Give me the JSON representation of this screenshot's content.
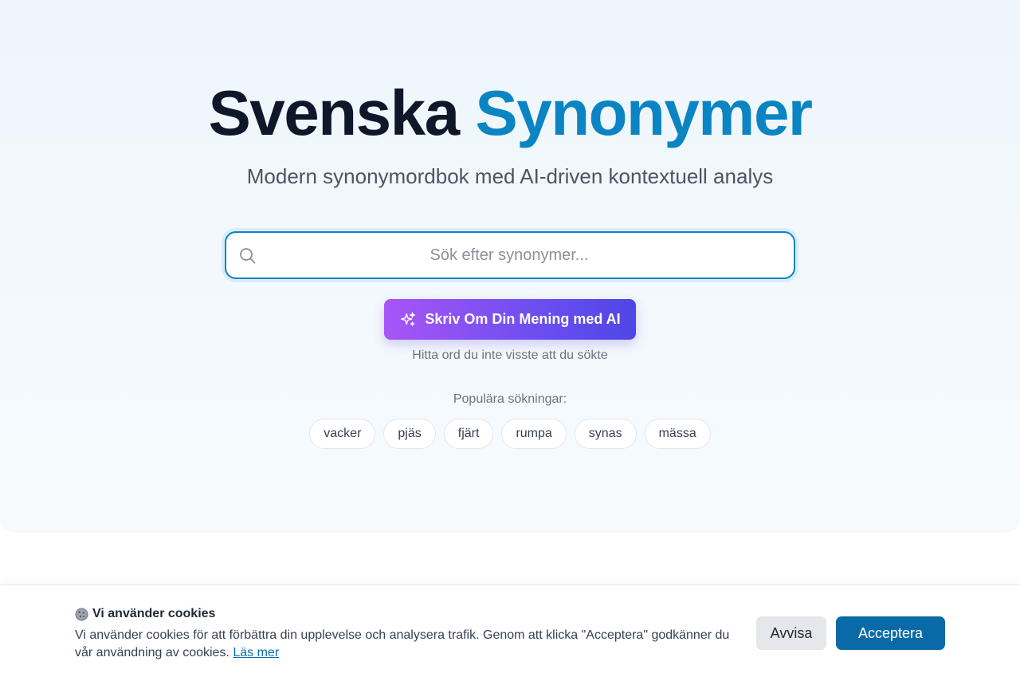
{
  "header": {
    "title_part1": "Svenska",
    "title_part2": "Synonymer",
    "subtitle": "Modern synonymordbok med AI-driven kontextuell analys"
  },
  "search": {
    "placeholder": "Sök efter synonymer...",
    "value": "",
    "icon": "search-icon"
  },
  "ai_button": {
    "label": "Skriv Om Din Mening med AI",
    "icon": "sparkles-icon",
    "hint": "Hitta ord du inte visste att du sökte"
  },
  "popular": {
    "label": "Populära sökningar:",
    "items": [
      "vacker",
      "pjäs",
      "fjärt",
      "rumpa",
      "synas",
      "mässa"
    ]
  },
  "cookie_banner": {
    "title": "Vi använder cookies",
    "icon": "cookie-icon",
    "text": "Vi använder cookies för att förbättra din upplevelse och analysera trafik. Genom att klicka \"Acceptera\" godkänner du vår användning av cookies.",
    "link_label": "Läs mer",
    "reject_label": "Avvisa",
    "accept_label": "Acceptera"
  },
  "colors": {
    "brand_blue": "#0a84c2",
    "ai_gradient_start": "#a855f7",
    "ai_gradient_end": "#4f46e5",
    "accept_button": "#0a6aa8"
  }
}
